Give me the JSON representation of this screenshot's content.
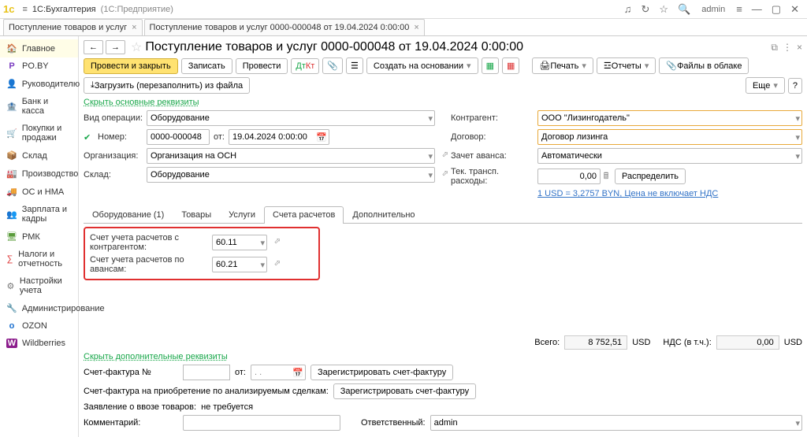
{
  "titlebar": {
    "logo": "1с",
    "app": "1С:Бухгалтерия",
    "edition": "(1С:Предприятие)",
    "user": "admin"
  },
  "doctabs": [
    {
      "label": "Поступление товаров и услуг"
    },
    {
      "label": "Поступление товаров и услуг 0000-000048 от 19.04.2024 0:00:00"
    }
  ],
  "sidebar": [
    {
      "icon": "🏠",
      "label": "Главное",
      "color": "#c9a21a"
    },
    {
      "icon": "Р",
      "label": "PO.BY",
      "color": "#7a3cc0"
    },
    {
      "icon": "👤",
      "label": "Руководителю",
      "color": "#19a74a"
    },
    {
      "icon": "🏦",
      "label": "Банк и касса",
      "color": "#d69c1e"
    },
    {
      "icon": "🛒",
      "label": "Покупки и продажи",
      "color": "#d33"
    },
    {
      "icon": "📦",
      "label": "Склад",
      "color": "#777"
    },
    {
      "icon": "🏭",
      "label": "Производство",
      "color": "#666"
    },
    {
      "icon": "🚚",
      "label": "ОС и НМА",
      "color": "#19a74a"
    },
    {
      "icon": "👥",
      "label": "Зарплата и кадры",
      "color": "#c9a21a"
    },
    {
      "icon": "🖥",
      "label": "РМК",
      "color": "#5a9c3b"
    },
    {
      "icon": "∑",
      "label": "Налоги и отчетность",
      "color": "#d33"
    },
    {
      "icon": "⚙",
      "label": "Настройки учета",
      "color": "#777"
    },
    {
      "icon": "🔧",
      "label": "Администрирование",
      "color": "#666"
    },
    {
      "icon": "o",
      "label": "OZON",
      "color": "#1a6fcf"
    },
    {
      "icon": "W",
      "label": "Wildberries",
      "color": "#8c1d8c"
    }
  ],
  "page": {
    "title": "Поступление товаров и услуг 0000-000048 от 19.04.2024 0:00:00"
  },
  "toolbar": {
    "post_close": "Провести и закрыть",
    "write": "Записать",
    "post": "Провести",
    "create_based": "Создать на основании",
    "print": "Печать",
    "reports": "Отчеты",
    "files": "Файлы в облаке",
    "load": "Загрузить (перезаполнить) из файла",
    "more": "Еще"
  },
  "link_hide_main": "Скрыть основные реквизиты",
  "form": {
    "op_type_label": "Вид операции:",
    "op_type": "Оборудование",
    "num_label": "Номер:",
    "num": "0000-000048",
    "from_label": "от:",
    "date": "19.04.2024  0:00:00",
    "org_label": "Организация:",
    "org": "Организация на ОСН",
    "wh_label": "Склад:",
    "wh": "Оборудование",
    "cp_label": "Контрагент:",
    "cp": "ООО \"Лизингодатель\"",
    "contract_label": "Договор:",
    "contract": "Договор лизинга",
    "advance_label": "Зачет аванса:",
    "advance": "Автоматически",
    "transp_label": "Тек. трансп. расходы:",
    "transp": "0,00",
    "dist": "Распределить",
    "rate_link": "1 USD = 3,2757 BYN, Цена не включает НДС"
  },
  "tabs": {
    "t1": "Оборудование (1)",
    "t2": "Товары",
    "t3": "Услуги",
    "t4": "Счета расчетов",
    "t5": "Дополнительно"
  },
  "accounts": {
    "l1": "Счет учета расчетов с контрагентом:",
    "v1": "60.11",
    "l2": "Счет учета расчетов по авансам:",
    "v2": "60.21"
  },
  "totals": {
    "label_total": "Всего:",
    "total": "8 752,51",
    "cur": "USD",
    "label_vat": "НДС (в т.ч.):",
    "vat": "0,00"
  },
  "footer": {
    "hide_add": "Скрыть дополнительные реквизиты",
    "sf_label": "Счет-фактура №",
    "sf_from": "от:",
    "sf_reg": "Зарегистрировать счет-фактуру",
    "sf2_label": "Счет-фактура на приобретение по анализируемым сделкам:",
    "decl_label": "Заявление о ввозе товаров:",
    "decl_val": "не требуется",
    "comment_label": "Комментарий:",
    "resp_label": "Ответственный:",
    "resp": "admin"
  }
}
